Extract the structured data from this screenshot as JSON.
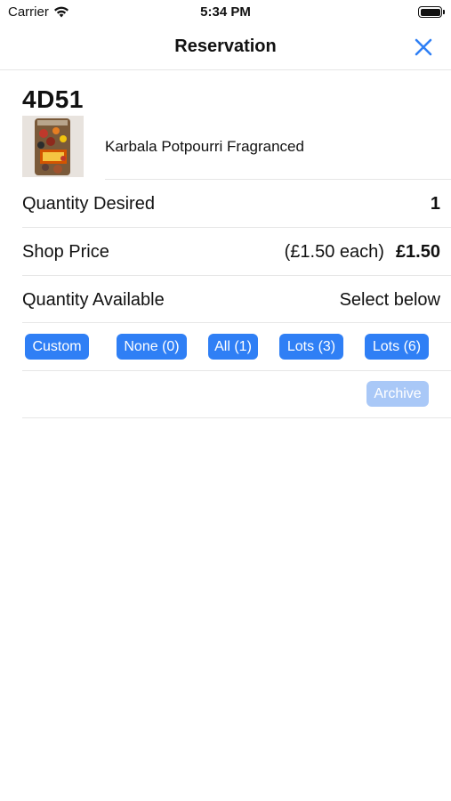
{
  "status_bar": {
    "carrier": "Carrier",
    "time": "5:34 PM",
    "icons": [
      "wifi-icon",
      "battery-icon"
    ]
  },
  "nav": {
    "title": "Reservation",
    "close_icon": "close-icon"
  },
  "item": {
    "code": "4D51",
    "name": "Karbala Potpourri Fragranced"
  },
  "quantity_desired": {
    "label": "Quantity Desired",
    "value": "1"
  },
  "shop_price": {
    "label": "Shop Price",
    "each": "(£1.50 each)",
    "total": "£1.50"
  },
  "quantity_available": {
    "label": "Quantity Available",
    "value": "Select below"
  },
  "options": {
    "custom": "Custom",
    "none": "None (0)",
    "all": "All (1)",
    "lots3": "Lots (3)",
    "lots6": "Lots (6)"
  },
  "archive": {
    "label": "Archive",
    "enabled": false
  },
  "colors": {
    "accent": "#2f7ff5",
    "accent_disabled": "#a9c8f7",
    "separator": "#e6e6e6"
  }
}
